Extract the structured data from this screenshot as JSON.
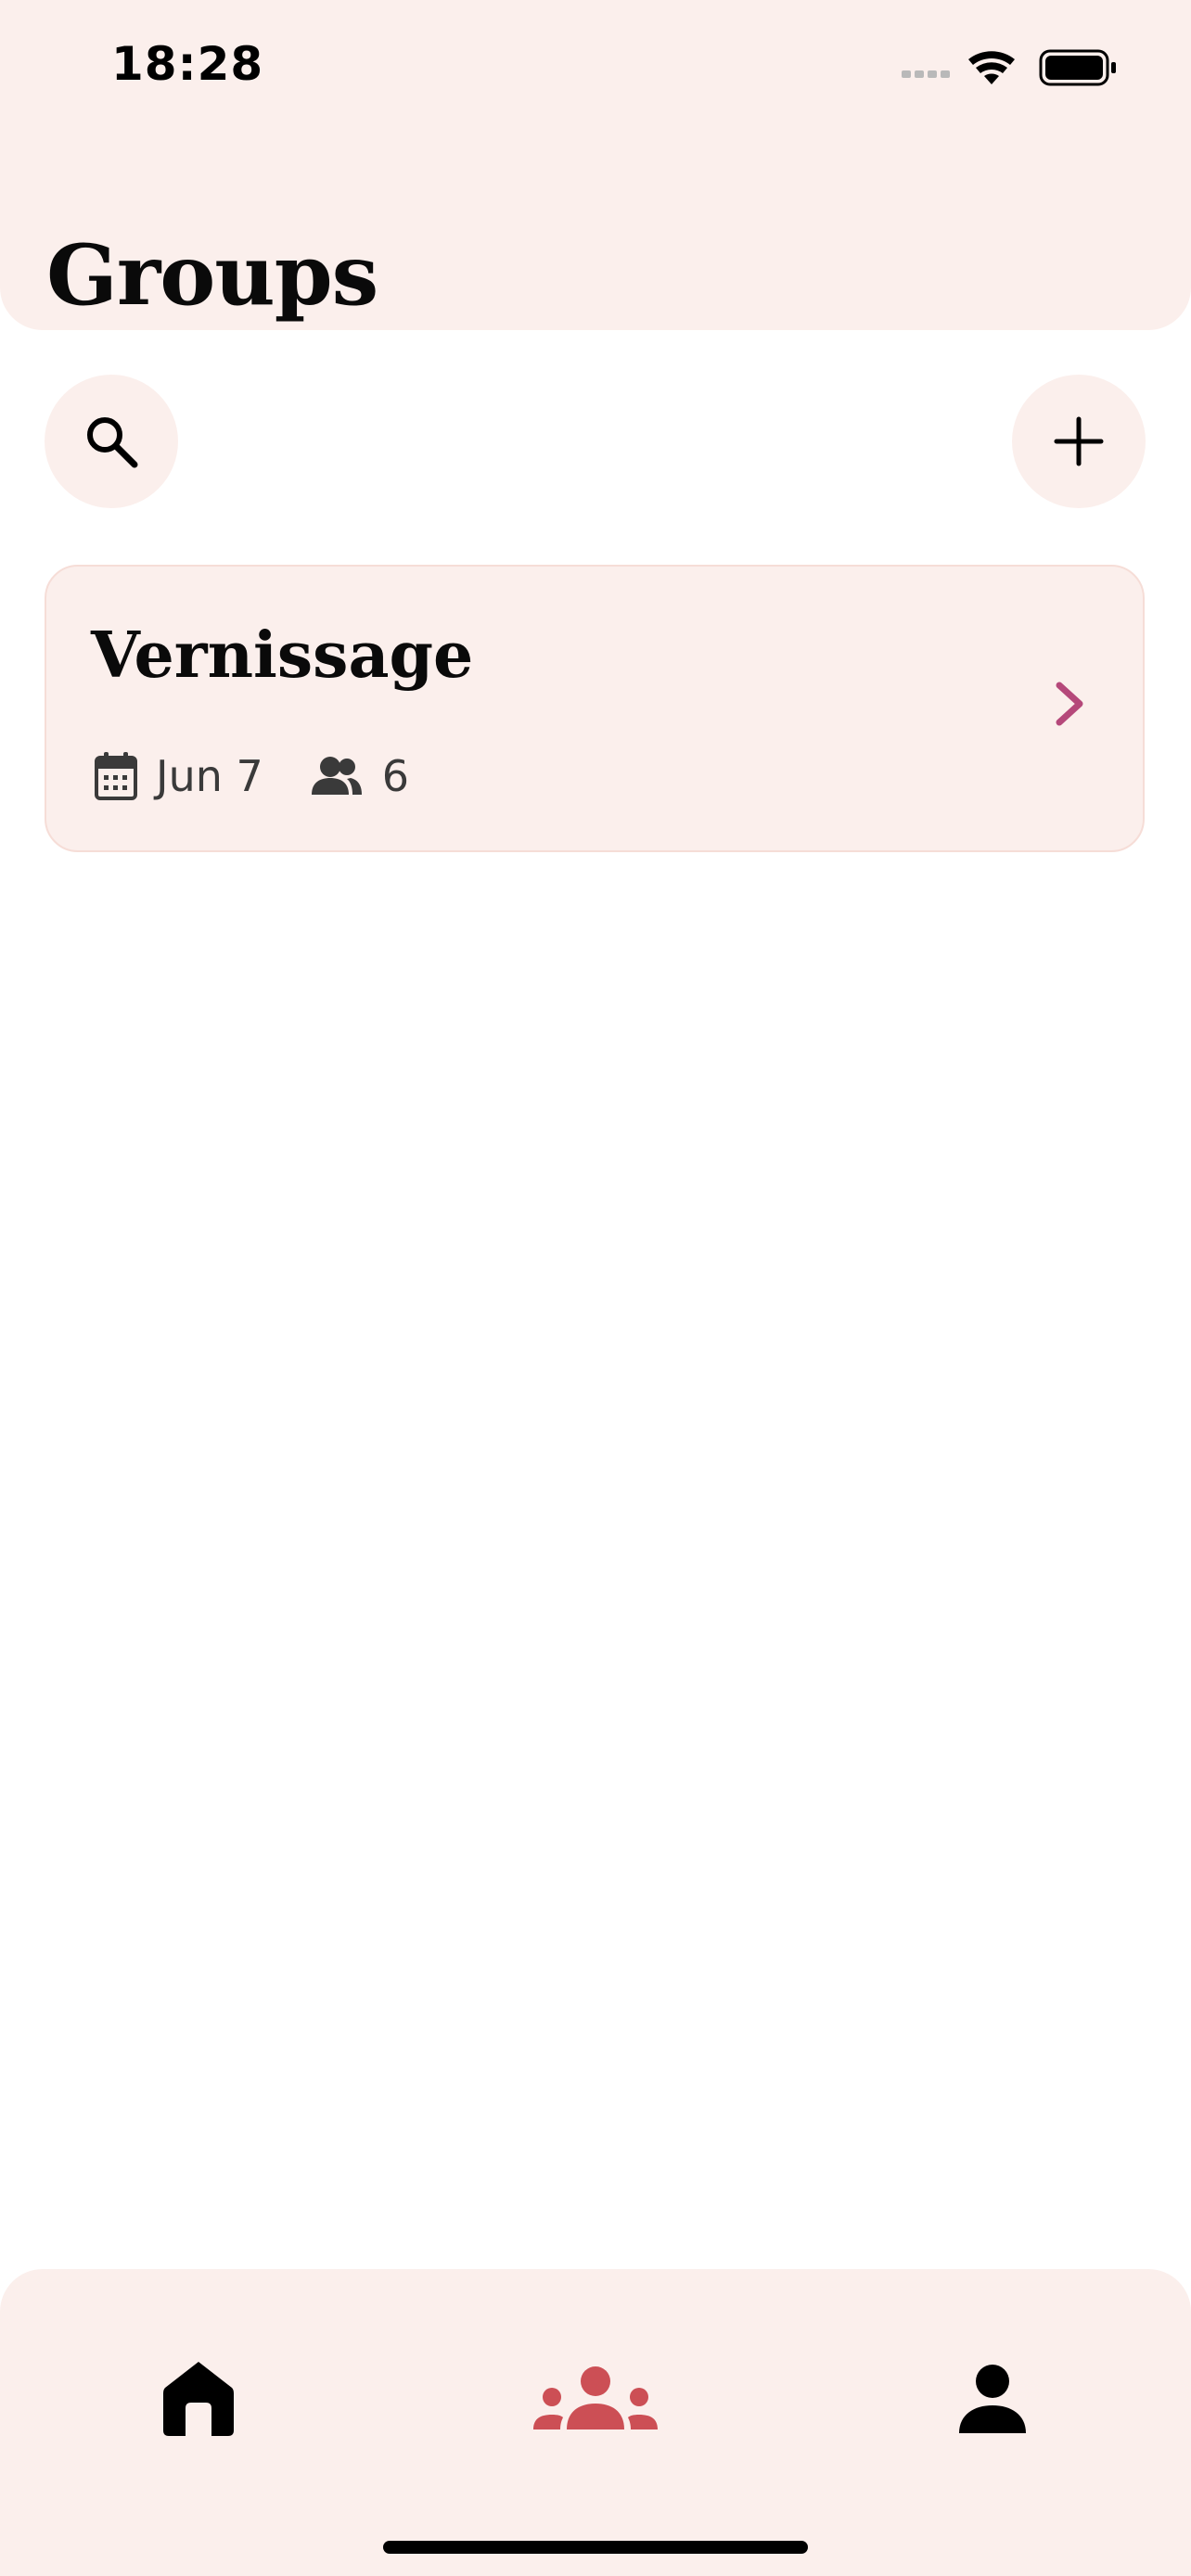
{
  "status_bar": {
    "time": "18:28"
  },
  "header": {
    "title": "Groups"
  },
  "toolbar": {
    "search_icon": "search-icon",
    "add_icon": "plus-icon"
  },
  "groups": [
    {
      "name": "Vernissage",
      "date": "Jun 7",
      "member_count": "6"
    }
  ],
  "tabbar": {
    "items": [
      {
        "icon": "home-icon",
        "active": false
      },
      {
        "icon": "groups-icon",
        "active": true
      },
      {
        "icon": "person-icon",
        "active": false
      }
    ]
  },
  "colors": {
    "surface": "#fbefec",
    "accent": "#cc4f55",
    "chevron": "#b5487a"
  }
}
